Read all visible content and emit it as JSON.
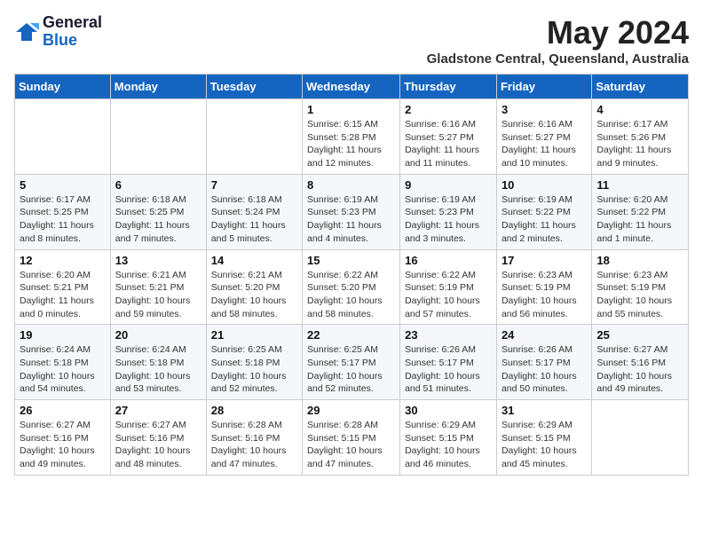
{
  "logo": {
    "general": "General",
    "blue": "Blue"
  },
  "title": {
    "month_year": "May 2024",
    "location": "Gladstone Central, Queensland, Australia"
  },
  "headers": [
    "Sunday",
    "Monday",
    "Tuesday",
    "Wednesday",
    "Thursday",
    "Friday",
    "Saturday"
  ],
  "weeks": [
    [
      {
        "day": "",
        "info": ""
      },
      {
        "day": "",
        "info": ""
      },
      {
        "day": "",
        "info": ""
      },
      {
        "day": "1",
        "info": "Sunrise: 6:15 AM\nSunset: 5:28 PM\nDaylight: 11 hours\nand 12 minutes."
      },
      {
        "day": "2",
        "info": "Sunrise: 6:16 AM\nSunset: 5:27 PM\nDaylight: 11 hours\nand 11 minutes."
      },
      {
        "day": "3",
        "info": "Sunrise: 6:16 AM\nSunset: 5:27 PM\nDaylight: 11 hours\nand 10 minutes."
      },
      {
        "day": "4",
        "info": "Sunrise: 6:17 AM\nSunset: 5:26 PM\nDaylight: 11 hours\nand 9 minutes."
      }
    ],
    [
      {
        "day": "5",
        "info": "Sunrise: 6:17 AM\nSunset: 5:25 PM\nDaylight: 11 hours\nand 8 minutes."
      },
      {
        "day": "6",
        "info": "Sunrise: 6:18 AM\nSunset: 5:25 PM\nDaylight: 11 hours\nand 7 minutes."
      },
      {
        "day": "7",
        "info": "Sunrise: 6:18 AM\nSunset: 5:24 PM\nDaylight: 11 hours\nand 5 minutes."
      },
      {
        "day": "8",
        "info": "Sunrise: 6:19 AM\nSunset: 5:23 PM\nDaylight: 11 hours\nand 4 minutes."
      },
      {
        "day": "9",
        "info": "Sunrise: 6:19 AM\nSunset: 5:23 PM\nDaylight: 11 hours\nand 3 minutes."
      },
      {
        "day": "10",
        "info": "Sunrise: 6:19 AM\nSunset: 5:22 PM\nDaylight: 11 hours\nand 2 minutes."
      },
      {
        "day": "11",
        "info": "Sunrise: 6:20 AM\nSunset: 5:22 PM\nDaylight: 11 hours\nand 1 minute."
      }
    ],
    [
      {
        "day": "12",
        "info": "Sunrise: 6:20 AM\nSunset: 5:21 PM\nDaylight: 11 hours\nand 0 minutes."
      },
      {
        "day": "13",
        "info": "Sunrise: 6:21 AM\nSunset: 5:21 PM\nDaylight: 10 hours\nand 59 minutes."
      },
      {
        "day": "14",
        "info": "Sunrise: 6:21 AM\nSunset: 5:20 PM\nDaylight: 10 hours\nand 58 minutes."
      },
      {
        "day": "15",
        "info": "Sunrise: 6:22 AM\nSunset: 5:20 PM\nDaylight: 10 hours\nand 58 minutes."
      },
      {
        "day": "16",
        "info": "Sunrise: 6:22 AM\nSunset: 5:19 PM\nDaylight: 10 hours\nand 57 minutes."
      },
      {
        "day": "17",
        "info": "Sunrise: 6:23 AM\nSunset: 5:19 PM\nDaylight: 10 hours\nand 56 minutes."
      },
      {
        "day": "18",
        "info": "Sunrise: 6:23 AM\nSunset: 5:19 PM\nDaylight: 10 hours\nand 55 minutes."
      }
    ],
    [
      {
        "day": "19",
        "info": "Sunrise: 6:24 AM\nSunset: 5:18 PM\nDaylight: 10 hours\nand 54 minutes."
      },
      {
        "day": "20",
        "info": "Sunrise: 6:24 AM\nSunset: 5:18 PM\nDaylight: 10 hours\nand 53 minutes."
      },
      {
        "day": "21",
        "info": "Sunrise: 6:25 AM\nSunset: 5:18 PM\nDaylight: 10 hours\nand 52 minutes."
      },
      {
        "day": "22",
        "info": "Sunrise: 6:25 AM\nSunset: 5:17 PM\nDaylight: 10 hours\nand 52 minutes."
      },
      {
        "day": "23",
        "info": "Sunrise: 6:26 AM\nSunset: 5:17 PM\nDaylight: 10 hours\nand 51 minutes."
      },
      {
        "day": "24",
        "info": "Sunrise: 6:26 AM\nSunset: 5:17 PM\nDaylight: 10 hours\nand 50 minutes."
      },
      {
        "day": "25",
        "info": "Sunrise: 6:27 AM\nSunset: 5:16 PM\nDaylight: 10 hours\nand 49 minutes."
      }
    ],
    [
      {
        "day": "26",
        "info": "Sunrise: 6:27 AM\nSunset: 5:16 PM\nDaylight: 10 hours\nand 49 minutes."
      },
      {
        "day": "27",
        "info": "Sunrise: 6:27 AM\nSunset: 5:16 PM\nDaylight: 10 hours\nand 48 minutes."
      },
      {
        "day": "28",
        "info": "Sunrise: 6:28 AM\nSunset: 5:16 PM\nDaylight: 10 hours\nand 47 minutes."
      },
      {
        "day": "29",
        "info": "Sunrise: 6:28 AM\nSunset: 5:15 PM\nDaylight: 10 hours\nand 47 minutes."
      },
      {
        "day": "30",
        "info": "Sunrise: 6:29 AM\nSunset: 5:15 PM\nDaylight: 10 hours\nand 46 minutes."
      },
      {
        "day": "31",
        "info": "Sunrise: 6:29 AM\nSunset: 5:15 PM\nDaylight: 10 hours\nand 45 minutes."
      },
      {
        "day": "",
        "info": ""
      }
    ]
  ]
}
